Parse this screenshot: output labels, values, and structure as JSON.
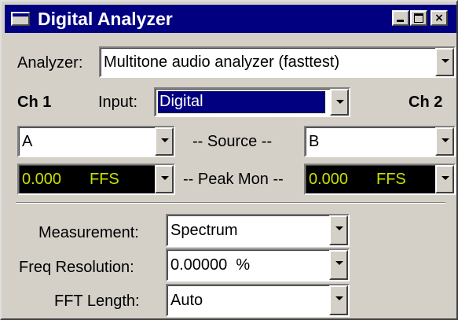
{
  "window": {
    "title": "Digital Analyzer"
  },
  "titlebar_buttons": {
    "minimize": "minimize-button",
    "maximize": "maximize-button",
    "close": "×"
  },
  "analyzer": {
    "label": "Analyzer:",
    "value": "Multitone audio analyzer (fasttest)"
  },
  "channels": {
    "ch1": "Ch 1",
    "ch2": "Ch 2"
  },
  "input": {
    "label": "Input:",
    "value": "Digital"
  },
  "source": {
    "label": "-- Source --",
    "ch1_value": "A",
    "ch2_value": "B"
  },
  "peak_mon": {
    "label": "-- Peak Mon --",
    "ch1_value": "0.000",
    "ch1_unit": "FFS",
    "ch2_value": "0.000",
    "ch2_unit": "FFS"
  },
  "measurement": {
    "label": "Measurement:",
    "value": "Spectrum"
  },
  "freq_resolution": {
    "label": "Freq Resolution:",
    "value": "0.00000  %"
  },
  "fft_length": {
    "label": "FFT Length:",
    "value": "Auto"
  },
  "colors": {
    "titlebar": "#000080",
    "meter_bg": "#000000",
    "meter_text": "#c8e000",
    "face": "#d4d0c8"
  }
}
